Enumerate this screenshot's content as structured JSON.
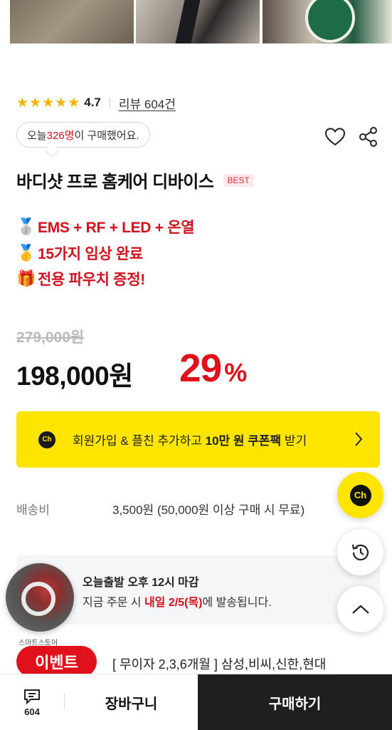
{
  "gallery": {
    "images": [
      "product-image-1",
      "product-image-2",
      "product-image-3"
    ]
  },
  "rating": {
    "stars": 4.7,
    "value": "4.7",
    "review_link": "리뷰 604건"
  },
  "purchase_bubble": {
    "prefix": "오늘 ",
    "count": "326명",
    "suffix": "이 구매했어요."
  },
  "product": {
    "title": "바디샷 프로 홈케어 디바이스",
    "badge": "BEST"
  },
  "promos": [
    {
      "icon": "medal-icon",
      "emoji": "🥈",
      "text": "EMS + RF + LED + 온열"
    },
    {
      "icon": "medal-icon",
      "emoji": "🥇",
      "text": "15가지 임상 완료"
    },
    {
      "icon": "gift-icon",
      "emoji": "🎁",
      "text": "전용 파우치 증정!"
    }
  ],
  "price": {
    "original": "279,000원",
    "current": "198,000원",
    "discount_num": "29",
    "discount_unit": "%"
  },
  "kakao_banner": {
    "badge": "Ch",
    "text_pre": "회원가입 & 플친 추가하고 ",
    "text_bold": "10만 원 쿠폰팩",
    "text_post": " 받기"
  },
  "shipping": {
    "label": "배송비",
    "value": "3,500원 (50,000원 이상 구매 시 무료)"
  },
  "dispatch_notice": {
    "line1": "오늘출발 오후 12시 마감",
    "line2_pre": "지금 주문 시 ",
    "line2_red": "내일 2/5(목)",
    "line2_post": "에 발송됩니다."
  },
  "store": {
    "label": "스마트스토어"
  },
  "event": {
    "button": "이벤트",
    "desc": "[ 무이자 2,3,6개월 ] 삼성,비씨,신한,현대"
  },
  "floating": {
    "channel_label": "Ch"
  },
  "bottom_bar": {
    "comment_count": "604",
    "cart": "장바구니",
    "buy": "구매하기"
  },
  "colors": {
    "accent_red": "#e0111b",
    "kakao_yellow": "#fee500",
    "star": "#f6b400",
    "buy_bg": "#1f1f1f"
  }
}
